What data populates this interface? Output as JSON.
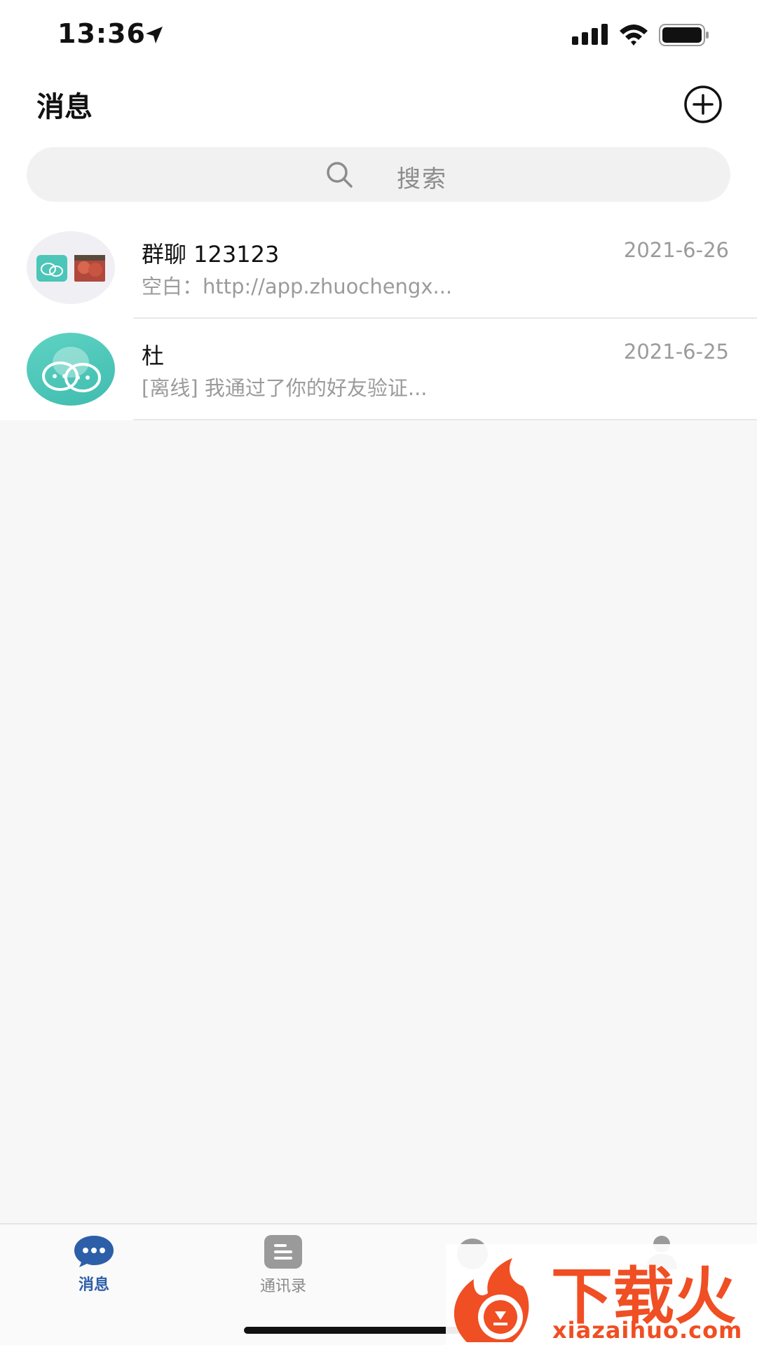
{
  "status_bar": {
    "time": "13:36"
  },
  "header": {
    "title": "消息"
  },
  "search": {
    "placeholder": "搜索"
  },
  "conversations": [
    {
      "name": "群聊 123123",
      "preview": "空白：http://app.zhuochengx...",
      "date": "2021-6-26"
    },
    {
      "name": "杜",
      "preview": "[离线] 我通过了你的好友验证...",
      "date": "2021-6-25"
    }
  ],
  "tabs": [
    {
      "label": "消息",
      "active": true
    },
    {
      "label": "通讯录",
      "active": false
    }
  ],
  "watermark": {
    "brand": "下载火",
    "url": "xiazaihuo.com"
  },
  "colors": {
    "accent": "#2d5fa8",
    "teal": "#4cc6b8",
    "watermark": "#f04e23"
  }
}
